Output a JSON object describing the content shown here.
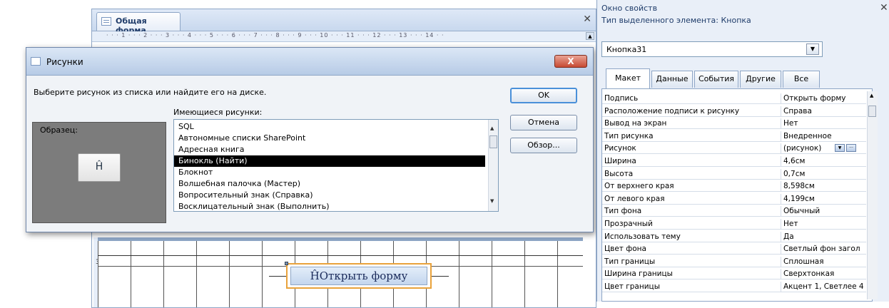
{
  "form_window": {
    "tab_label": "Общая форма",
    "close_glyph": "✕",
    "ruler_text": "· · · 1 · · · 2 · · · 3 · · · 4 · · · 5 · · · 6 · · · 7 · · · 8 · · · 9 · · · 10 · · · 11 · · · 12 · · · 13 · · · 14 · ·",
    "vertical_ruler_number": "3",
    "open_form_button_label": "ĤОткрыть форму"
  },
  "pictures_dialog": {
    "title": "Рисунки",
    "close_glyph": "X",
    "instruction": "Выберите рисунок из списка или найдите его на диске.",
    "available_label": "Имеющиеся рисунки:",
    "sample_label": "Образец:",
    "sample_icon": "Ĥ",
    "items": [
      {
        "label": "SQL",
        "selected": false
      },
      {
        "label": "Автономные списки SharePoint",
        "selected": false
      },
      {
        "label": "Адресная книга",
        "selected": false
      },
      {
        "label": "Бинокль (Найти)",
        "selected": true
      },
      {
        "label": "Блокнот",
        "selected": false
      },
      {
        "label": "Волшебная палочка (Мастер)",
        "selected": false
      },
      {
        "label": "Вопросительный знак (Справка)",
        "selected": false
      },
      {
        "label": "Восклицательный знак (Выполнить)",
        "selected": false
      }
    ],
    "buttons": {
      "ok": "OK",
      "cancel": "Отмена",
      "browse": "Обзор..."
    }
  },
  "property_sheet": {
    "title": "Окно свойств",
    "close_glyph": "✕",
    "selection_type": "Тип выделенного элемента:  Кнопка",
    "combo_value": "Кнопка31",
    "tabs": [
      "Макет",
      "Данные",
      "События",
      "Другие",
      "Все"
    ],
    "active_tab": "Макет",
    "rows": [
      {
        "name": "Подпись",
        "value": "Открыть форму"
      },
      {
        "name": "Расположение подписи к рисунку",
        "value": "Справа"
      },
      {
        "name": "Вывод на экран",
        "value": "Нет"
      },
      {
        "name": "Тип рисунка",
        "value": "Внедренное"
      },
      {
        "name": "Рисунок",
        "value": "(рисунок)"
      },
      {
        "name": "Ширина",
        "value": "4,6см"
      },
      {
        "name": "Высота",
        "value": "0,7см"
      },
      {
        "name": "От верхнего края",
        "value": "8,598см"
      },
      {
        "name": "От левого края",
        "value": "4,199см"
      },
      {
        "name": "Тип фона",
        "value": "Обычный"
      },
      {
        "name": "Прозрачный",
        "value": "Нет"
      },
      {
        "name": "Использовать тему",
        "value": "Да"
      },
      {
        "name": "Цвет фона",
        "value": "Светлый фон загол"
      },
      {
        "name": "Тип границы",
        "value": "Сплошная"
      },
      {
        "name": "Ширина границы",
        "value": "Сверхтонкая"
      },
      {
        "name": "Цвет границы",
        "value": "Акцент 1, Светлее 4"
      }
    ]
  }
}
